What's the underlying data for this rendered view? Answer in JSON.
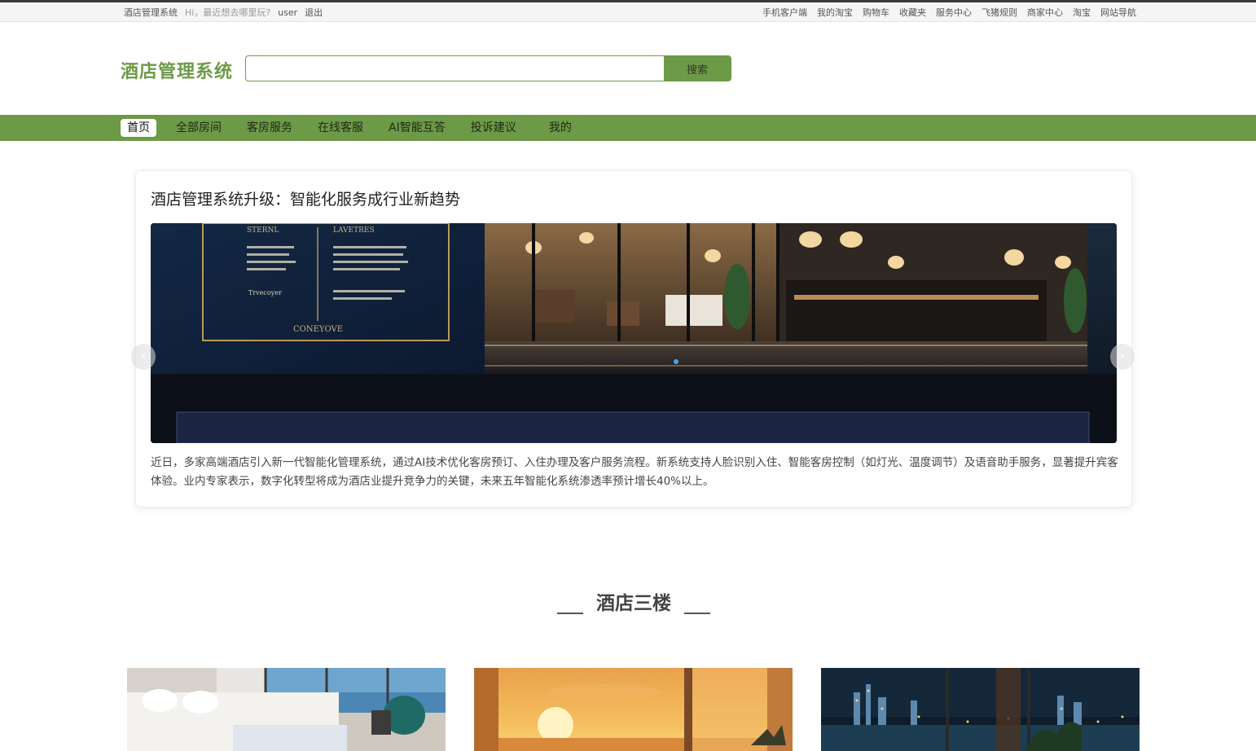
{
  "topbar": {
    "brand": "酒店管理系统",
    "greeting": "Hi，最近想去哪里玩?",
    "user": "user",
    "logout": "退出",
    "links": [
      "手机客户端",
      "我的淘宝",
      "购物车",
      "收藏夹",
      "服务中心",
      "飞猪规则",
      "商家中心",
      "淘宝",
      "网站导航"
    ]
  },
  "header": {
    "logo": "酒店管理系统",
    "search_placeholder": "",
    "search_button": "搜索"
  },
  "nav": {
    "items": [
      "首页",
      "全部房间",
      "客房服务",
      "在线客服",
      "AI智能互答",
      "投诉建议",
      "我的"
    ],
    "active": "首页"
  },
  "news": {
    "title": "酒店管理系统升级：智能化服务成行业新趋势",
    "body": "近日，多家高端酒店引入新一代智能化管理系统，通过AI技术优化客房预订、入住办理及客户服务流程。新系统支持人脸识别入住、智能客房控制（如灯光、温度调节）及语音助手服务，显著提升宾客体验。业内专家表示，数字化转型将成为酒店业提升竞争力的关键，未来五年智能化系统渗透率预计增长40%以上。",
    "banner_sign_left": "STERNL",
    "banner_sign_right": "LAVETRES",
    "banner_sign_bottom": "CONEYOVE",
    "banner_sign_mid": "Trvecoyer",
    "prev": "‹",
    "next": "›"
  },
  "section": {
    "title": "酒店三楼"
  },
  "colors": {
    "accent": "#6d9a47",
    "nav_bg": "#6d9a47"
  }
}
